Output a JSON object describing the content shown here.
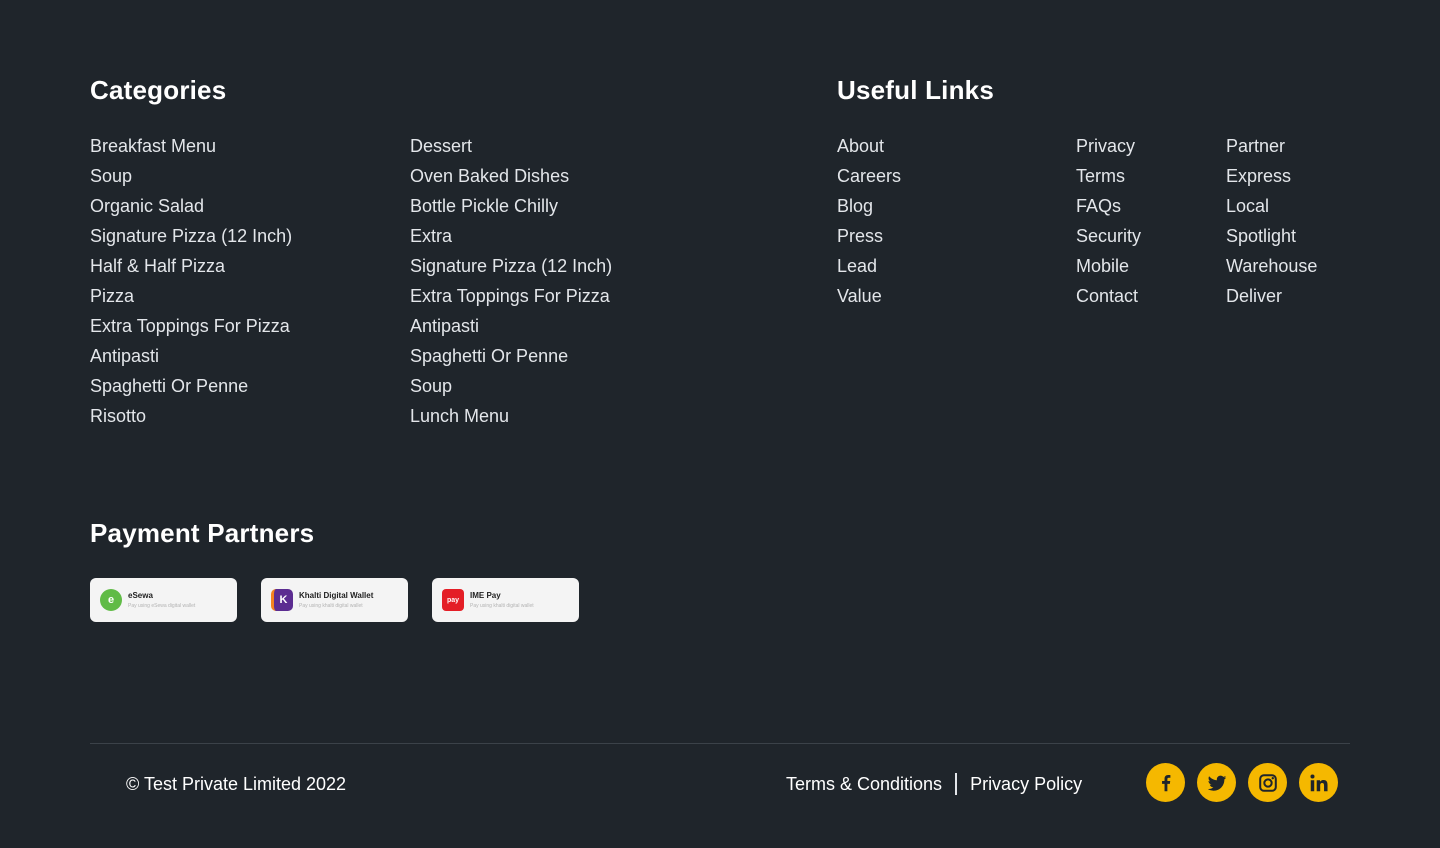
{
  "categories": {
    "heading": "Categories",
    "col1": [
      "Breakfast Menu",
      "Soup",
      "Organic Salad",
      "Signature Pizza (12 Inch)",
      "Half & Half Pizza",
      "Pizza",
      "Extra Toppings For Pizza",
      "Antipasti",
      "Spaghetti Or Penne",
      "Risotto"
    ],
    "col2": [
      "Dessert",
      "Oven Baked Dishes",
      "Bottle Pickle Chilly",
      "Extra",
      "Signature Pizza (12 Inch)",
      "Extra Toppings For Pizza",
      "Antipasti",
      "Spaghetti Or Penne",
      "Soup",
      "Lunch Menu"
    ]
  },
  "useful_links": {
    "heading": "Useful Links",
    "col1": [
      "About",
      "Careers",
      "Blog",
      "Press",
      "Lead",
      "Value"
    ],
    "col2": [
      "Privacy",
      "Terms",
      "FAQs",
      "Security",
      "Mobile",
      "Contact"
    ],
    "col3": [
      "Partner",
      "Express",
      "Local",
      "Spotlight",
      "Warehouse",
      "Deliver"
    ]
  },
  "payment": {
    "heading": "Payment Partners",
    "partners": [
      {
        "name": "eSewa",
        "sub": "Pay using eSewa digital wallet",
        "logo_text": "e",
        "color": "#60bb46"
      },
      {
        "name": "Khalti Digital Wallet",
        "sub": "Pay using khalti digital wallet",
        "logo_text": "K",
        "color": "#5c2d91"
      },
      {
        "name": "IME Pay",
        "sub": "Pay using khalti digital wallet",
        "logo_text": "pay",
        "color": "#e41e26"
      }
    ]
  },
  "footer": {
    "copyright": "© Test Private Limited 2022",
    "terms": "Terms & Conditions",
    "privacy": "Privacy Policy",
    "social": [
      "facebook-icon",
      "twitter-icon",
      "instagram-icon",
      "linkedin-icon"
    ],
    "accent": "#f5b800"
  }
}
